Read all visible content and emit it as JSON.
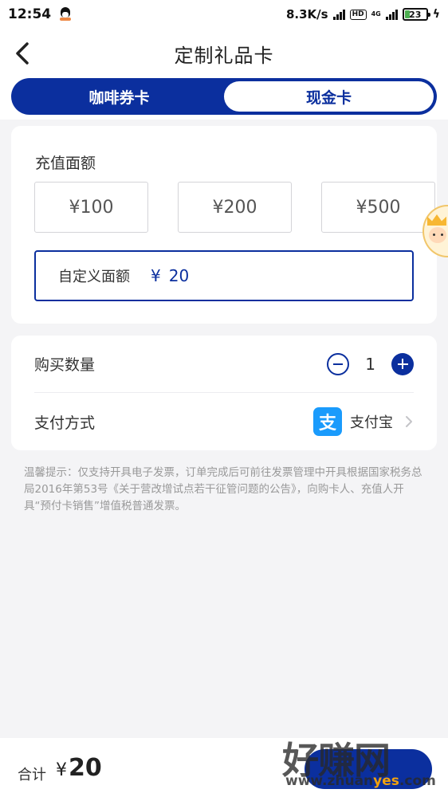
{
  "status_bar": {
    "time": "12:54",
    "network_speed": "8.3K/s",
    "hd": "HD",
    "net_type": "4G",
    "battery": "23"
  },
  "header": {
    "title": "定制礼品卡"
  },
  "tabs": [
    {
      "label": "咖啡券卡",
      "active": false
    },
    {
      "label": "现金卡",
      "active": true
    }
  ],
  "recharge": {
    "label": "充值面额",
    "options": [
      "¥100",
      "¥200",
      "¥500"
    ],
    "custom_label": "自定义面额",
    "custom_currency": "¥",
    "custom_value": "20"
  },
  "order": {
    "quantity_label": "购买数量",
    "quantity": "1",
    "payment_label": "支付方式",
    "payment_method": "支付宝",
    "payment_icon_glyph": "支"
  },
  "notice": "温馨提示：仅支持开具电子发票，订单完成后可前往发票管理中开具根据国家税务总局2016年第53号《关于营改增试点若干征管问题的公告》，向购卡人、充值人开具“预付卡销售”增值税普通发票。",
  "footer": {
    "total_label": "合计",
    "currency": "¥",
    "total_value": "20"
  },
  "watermark": {
    "big": "好赚网",
    "small_prefix": "www.zhuan",
    "small_highlight": "yes",
    "small_suffix": ".com"
  },
  "colors": {
    "primary": "#0b2f9e",
    "background": "#f4f4f6",
    "alipay": "#1a9bfc"
  }
}
